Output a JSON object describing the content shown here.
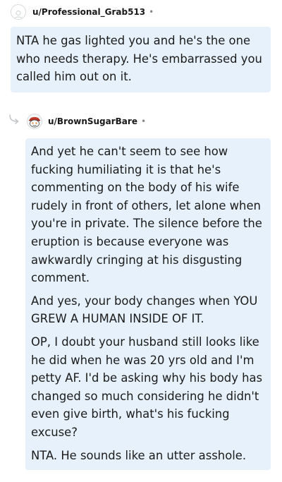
{
  "comments": [
    {
      "username": "u/Professional_Grab513",
      "separator": "•",
      "avatar_icon": "default-avatar-icon",
      "paragraphs": [
        "NTA he gas lighted you and he's the one who needs therapy. He's embarrassed you called him out on it."
      ]
    },
    {
      "username": "u/BrownSugarBare",
      "separator": "•",
      "avatar_icon": "snoo-avatar-icon",
      "reply_icon": "reply-arrow-icon",
      "paragraphs": [
        "And yet he can't seem to see how fucking humiliating it is that he's commenting on the body of his wife rudely in front of others, let alone when you're in private. The silence before the eruption is because everyone was awkwardly cringing at his disgusting comment.",
        "And yes, your body changes when YOU GREW A HUMAN INSIDE OF IT.",
        "OP, I doubt your husband still looks like he did when he was 20 yrs old and I'm petty AF. I'd be asking why his body has changed so much considering he didn't even give birth, what's his fucking excuse?",
        "NTA. He sounds like an utter asshole."
      ]
    }
  ],
  "colors": {
    "bubble_bg": "#e6f1fb",
    "text": "#1c1c1c",
    "muted": "#878a8c"
  }
}
